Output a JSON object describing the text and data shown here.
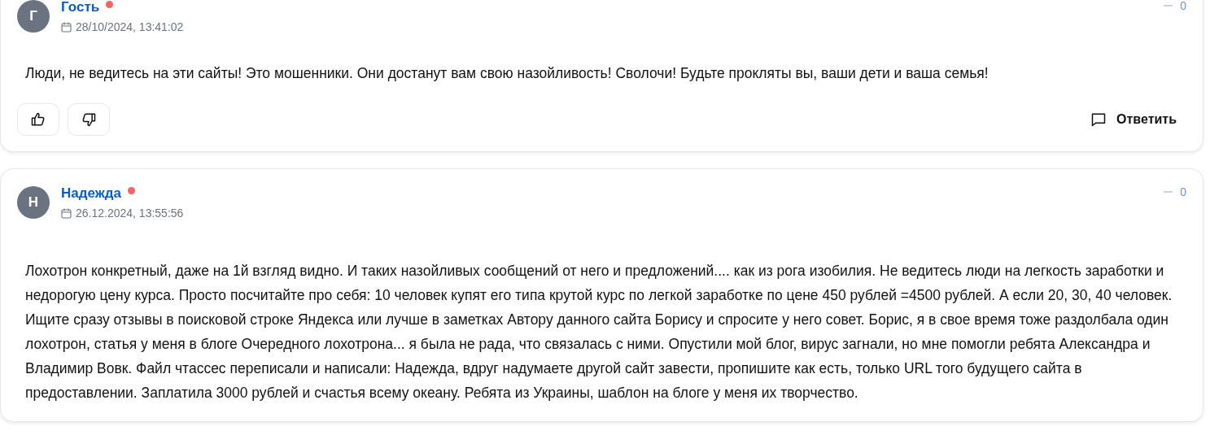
{
  "comments": [
    {
      "initial": "Г",
      "author": "Гость",
      "online": true,
      "date": "28/10/2024, 13:41:02",
      "score": "0",
      "text": "Люди, не ведитесь на эти сайты! Это мошенники. Они достанут вам свою назойливость! Сволочи! Будьте прокляты вы, ваши дети и ваша семья!",
      "reply": "Ответить"
    },
    {
      "initial": "Н",
      "author": "Надежда",
      "online": true,
      "date": "26.12.2024, 13:55:56",
      "score": "0",
      "text": "Лохотрон конкретный, даже на 1й взгляд видно. И таких назойливых сообщений от него и предложений.... как из рога изобилия. Не ведитесь люди на легкость заработки и недорогую цену курса. Просто посчитайте про себя: 10 человек купят его типа крутой курс по легкой заработке по цене 450 рублей =4500 рублей. А если 20, 30, 40 человек. Ищите сразу отзывы в поисковой строке Яндекса или лучше в заметках Автору данного сайта Борису и спросите у него совет. Борис, я в свое время тоже раздолбала один лохотрон, статья у меня в блоге Очередного лохотрона... я была не рада, что связалась с ними. Опустили мой блог, вирус загнали, но мне помогли ребята Александра и Владимир Вовк. Файл чтассес переписали и написали: Надежда, вдруг надумаете другой сайт завести, пропишите как есть, только URL того будущего сайта в предоставлении. Заплатила 3000 рублей и счастья всему океану. Ребята из Украины, шаблон на блоге у меня их творчество."
    }
  ]
}
